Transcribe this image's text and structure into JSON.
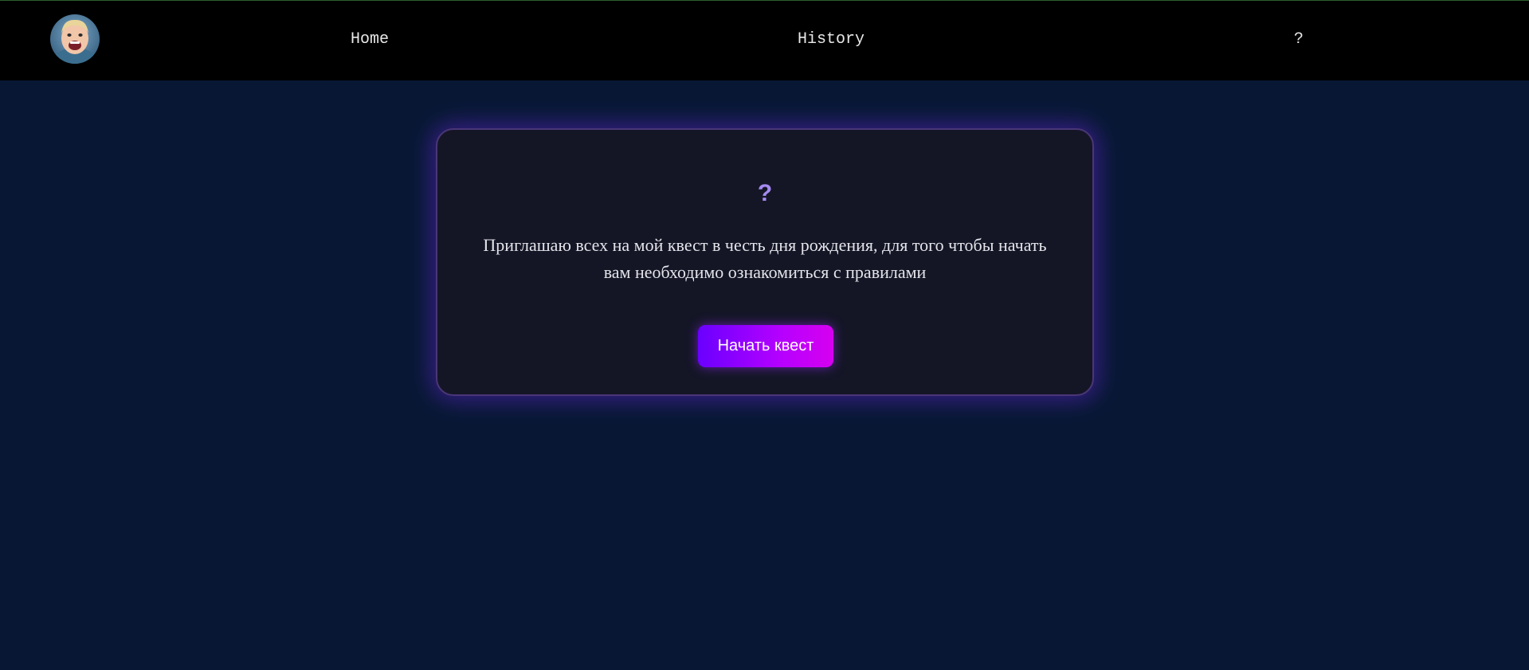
{
  "nav": {
    "avatar_icon": "child-photo-avatar",
    "home_label": "Home",
    "history_label": "History",
    "help_label": "?"
  },
  "card": {
    "icon": "?",
    "text": "Приглашаю всех на мой квест в честь дня рождения, для того чтобы начать вам необходимо ознакомиться с правилами",
    "button_label": "Начать квест"
  },
  "colors": {
    "page_background": "#081834",
    "navbar_background": "#000000",
    "card_background": "#141626",
    "card_border": "#4a3676",
    "accent_purple": "#a58af0",
    "button_gradient_start": "#6a00ff",
    "button_gradient_end": "#d600f0"
  }
}
